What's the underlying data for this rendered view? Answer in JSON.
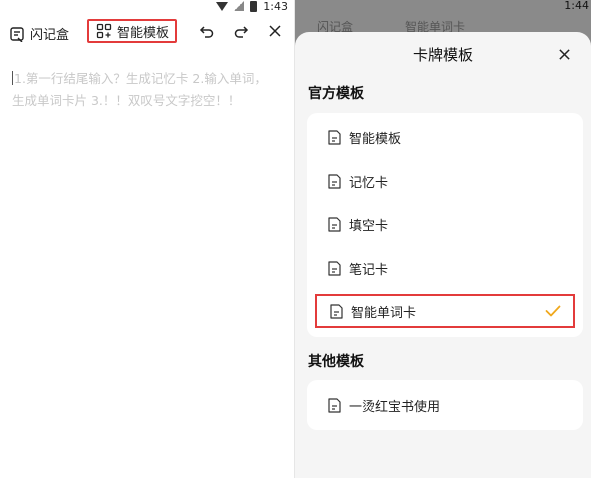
{
  "left": {
    "status": {
      "time": "1:43"
    },
    "toolbar": {
      "flash_label": "闪记盒",
      "smart_label": "智能模板"
    },
    "editor": {
      "placeholder_line1": "1.第一行结尾输入？生成记忆卡 2.输入单词，",
      "placeholder_line2": "生成单词卡片 3.！！双叹号文字挖空！！"
    }
  },
  "right": {
    "status": {
      "time": "1:44",
      "ghost_left": "闪记盒",
      "ghost_mid": "智能单词卡"
    },
    "sheet": {
      "title": "卡牌模板",
      "official_title": "官方模板",
      "official_items": [
        {
          "label": "智能模板"
        },
        {
          "label": "记忆卡"
        },
        {
          "label": "填空卡"
        },
        {
          "label": "笔记卡"
        },
        {
          "label": "智能单词卡",
          "selected": true
        }
      ],
      "other_title": "其他模板",
      "other_items": [
        {
          "label": "一烫红宝书使用"
        }
      ]
    }
  },
  "colors": {
    "highlight": "#e33b3b",
    "check": "#f0a81c"
  }
}
